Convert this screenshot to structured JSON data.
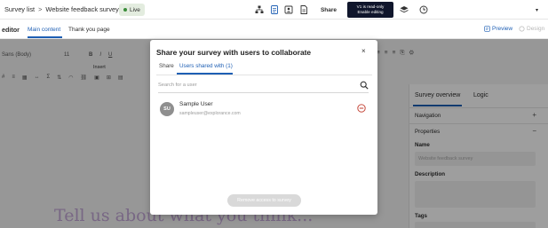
{
  "topbar": {
    "breadcrumb_root": "Survey list",
    "breadcrumb_separator": ">",
    "survey_name": "Website feedback survey",
    "status_badge": "Live",
    "share_label": "Share",
    "readonly_line1": "V1 is read-only",
    "readonly_line2": "Enable editing",
    "icons": [
      "sitemap-icon",
      "document-icon",
      "people-icon",
      "document-alt-icon",
      "layers-icon",
      "history-icon",
      "chevron-down-icon"
    ]
  },
  "subbar": {
    "editor_label": "editor",
    "tab_main": "Main content",
    "tab_thanks": "Thank you page",
    "preview_label": "Preview",
    "design_label": "Design"
  },
  "editor": {
    "font_name": "Sans (Body)",
    "font_size": "11",
    "insert_label": "Insert",
    "heading_text": "Tell us about what you think..."
  },
  "right_panel": {
    "tab_overview": "Survey overview",
    "tab_logic": "Logic",
    "navigation_label": "Navigation",
    "properties_label": "Properties",
    "name_label": "Name",
    "name_value": "Website feedback survey",
    "description_label": "Description",
    "tags_label": "Tags"
  },
  "modal": {
    "title": "Share your survey with users to collaborate",
    "close_symbol": "×",
    "share_tab": "Share",
    "users_tab": "Users shared with (1)",
    "search_placeholder": "Search for a user",
    "users": [
      {
        "initials": "SU",
        "name": "Sample User",
        "email": "sampleuser@explorance.com"
      }
    ],
    "remove_button": "Remove access to survey"
  },
  "colors": {
    "accent": "#1e5fb4",
    "dark_badge": "#10162c",
    "live_badge_bg": "#e3ecdf",
    "remove_icon": "#c0392b",
    "heading_color": "#c2a6d6"
  }
}
